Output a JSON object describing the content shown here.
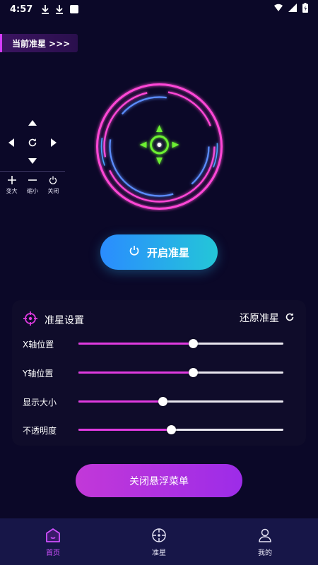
{
  "status_bar": {
    "time": "4:57",
    "left_icons": [
      "download-icon",
      "download-icon",
      "notification-square-icon"
    ],
    "right_icons": [
      "signal-icon",
      "wifi-icon",
      "battery-icon"
    ]
  },
  "current_crosshair": {
    "label": "当前准星 >>>"
  },
  "side_controls": {
    "dpad_icons": [
      "arrow-up-icon",
      "arrow-left-icon",
      "reset-icon",
      "arrow-right-icon",
      "arrow-down-icon"
    ],
    "buttons": [
      {
        "label": "变大",
        "icon": "plus-icon"
      },
      {
        "label": "缩小",
        "icon": "minus-icon"
      },
      {
        "label": "关闭",
        "icon": "power-icon"
      }
    ]
  },
  "start_button": {
    "label": "开启准星",
    "icon": "power-icon"
  },
  "settings": {
    "title": "准星设置",
    "restore_label": "还原准星",
    "sliders": [
      {
        "label": "X轴位置",
        "value": 0.56
      },
      {
        "label": "Y轴位置",
        "value": 0.56
      },
      {
        "label": "显示大小",
        "value": 0.41
      },
      {
        "label": "不透明度",
        "value": 0.45
      }
    ]
  },
  "close_menu_button": {
    "label": "关闭悬浮菜单"
  },
  "bottom_nav": {
    "items": [
      {
        "label": "首页",
        "icon": "home-icon",
        "active": true
      },
      {
        "label": "准星",
        "icon": "crosshair-icon",
        "active": false
      },
      {
        "label": "我的",
        "icon": "user-icon",
        "active": false
      }
    ]
  },
  "colors": {
    "background": "#0b0828",
    "accent_pink": "#e03be0",
    "accent_cyan": "#24c6d8",
    "accent_blue": "#2a8cff",
    "nav_background": "#171648",
    "active_nav": "#d050ff",
    "crosshair_green": "#6cf032"
  }
}
